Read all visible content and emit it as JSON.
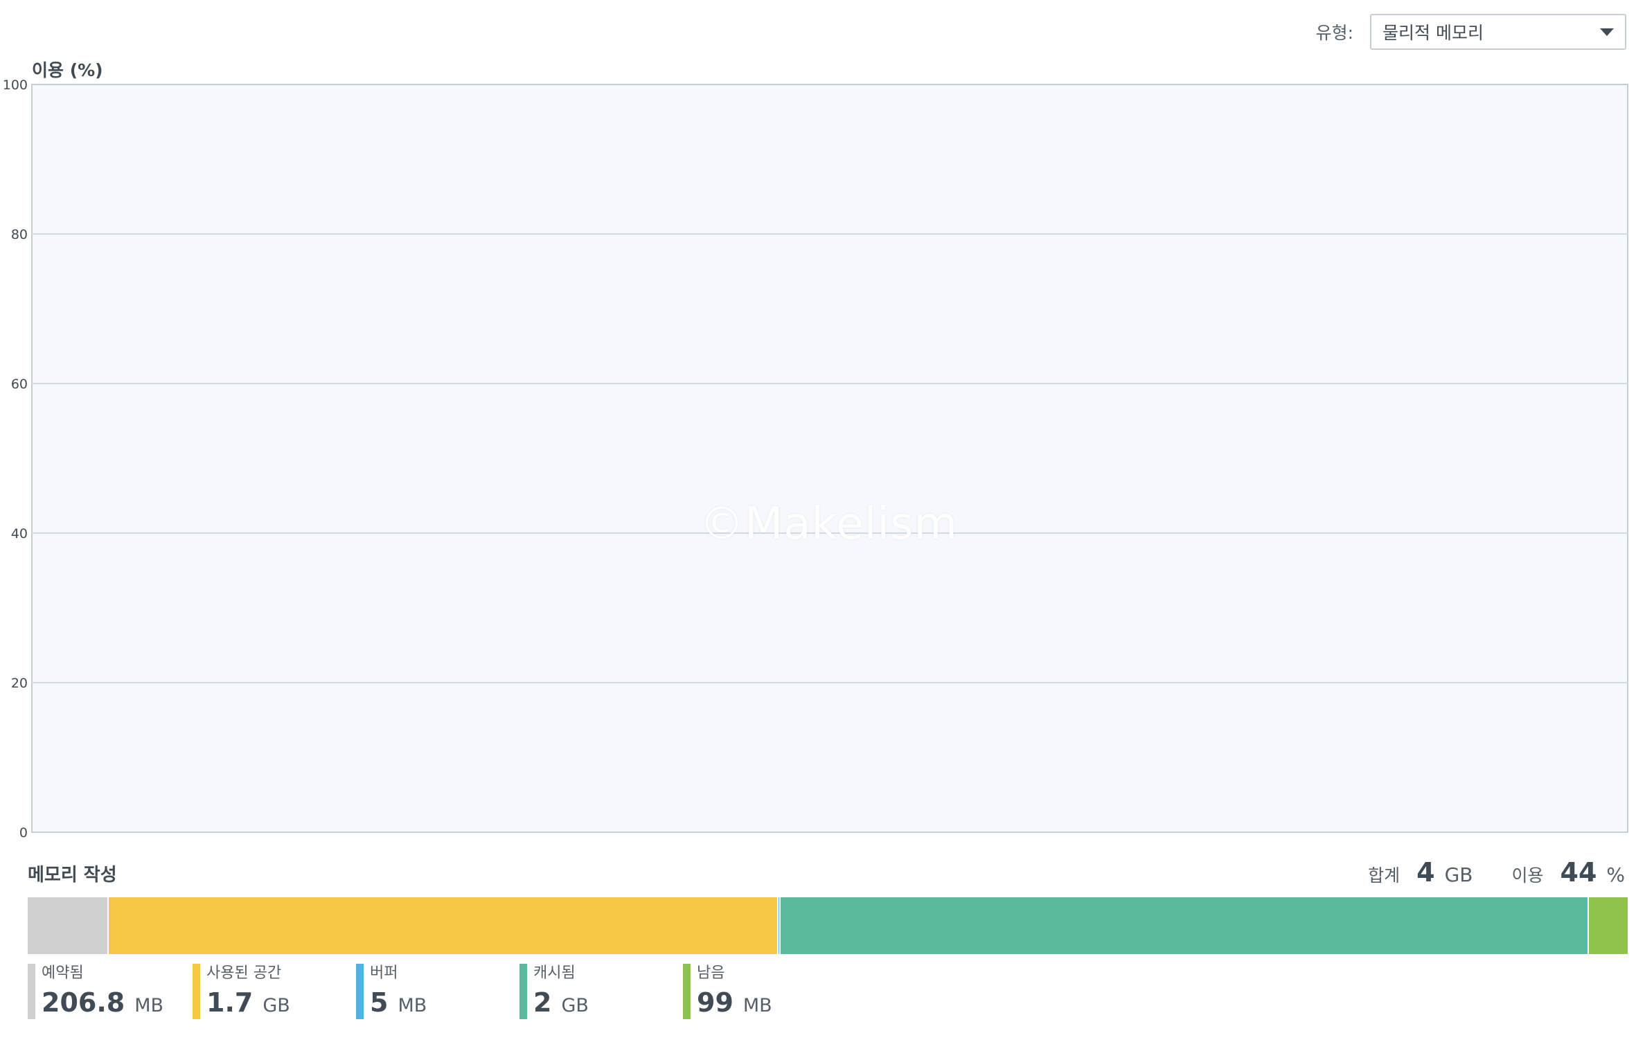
{
  "filter": {
    "label": "유형:",
    "selected": "물리적 메모리"
  },
  "chart_data": {
    "type": "line",
    "ylabel": "이용 (%)",
    "ylim": [
      0,
      100
    ],
    "yticks": [
      "100",
      "80",
      "60",
      "40",
      "20",
      "0"
    ],
    "grid": true,
    "background": "#f5f8fc",
    "series": []
  },
  "watermark": "©Makelism",
  "composition": {
    "title": "메모리 작성",
    "total_label": "합계",
    "total_value": "4",
    "total_unit": "GB",
    "usage_label": "이용",
    "usage_value": "44",
    "usage_unit": "%",
    "segments": [
      {
        "label": "예약됨",
        "value": "206.8",
        "unit": "MB",
        "mb": 206.8,
        "color": "#cfcfcf"
      },
      {
        "label": "사용된 공간",
        "value": "1.7",
        "unit": "GB",
        "mb": 1715,
        "color": "#f6c744"
      },
      {
        "label": "버퍼",
        "value": "5",
        "unit": "MB",
        "mb": 5,
        "color": "#4fb2e3"
      },
      {
        "label": "캐시됨",
        "value": "2",
        "unit": "GB",
        "mb": 2070,
        "color": "#5bba9d"
      },
      {
        "label": "남음",
        "value": "99",
        "unit": "MB",
        "mb": 99,
        "color": "#8fc24a"
      }
    ]
  }
}
